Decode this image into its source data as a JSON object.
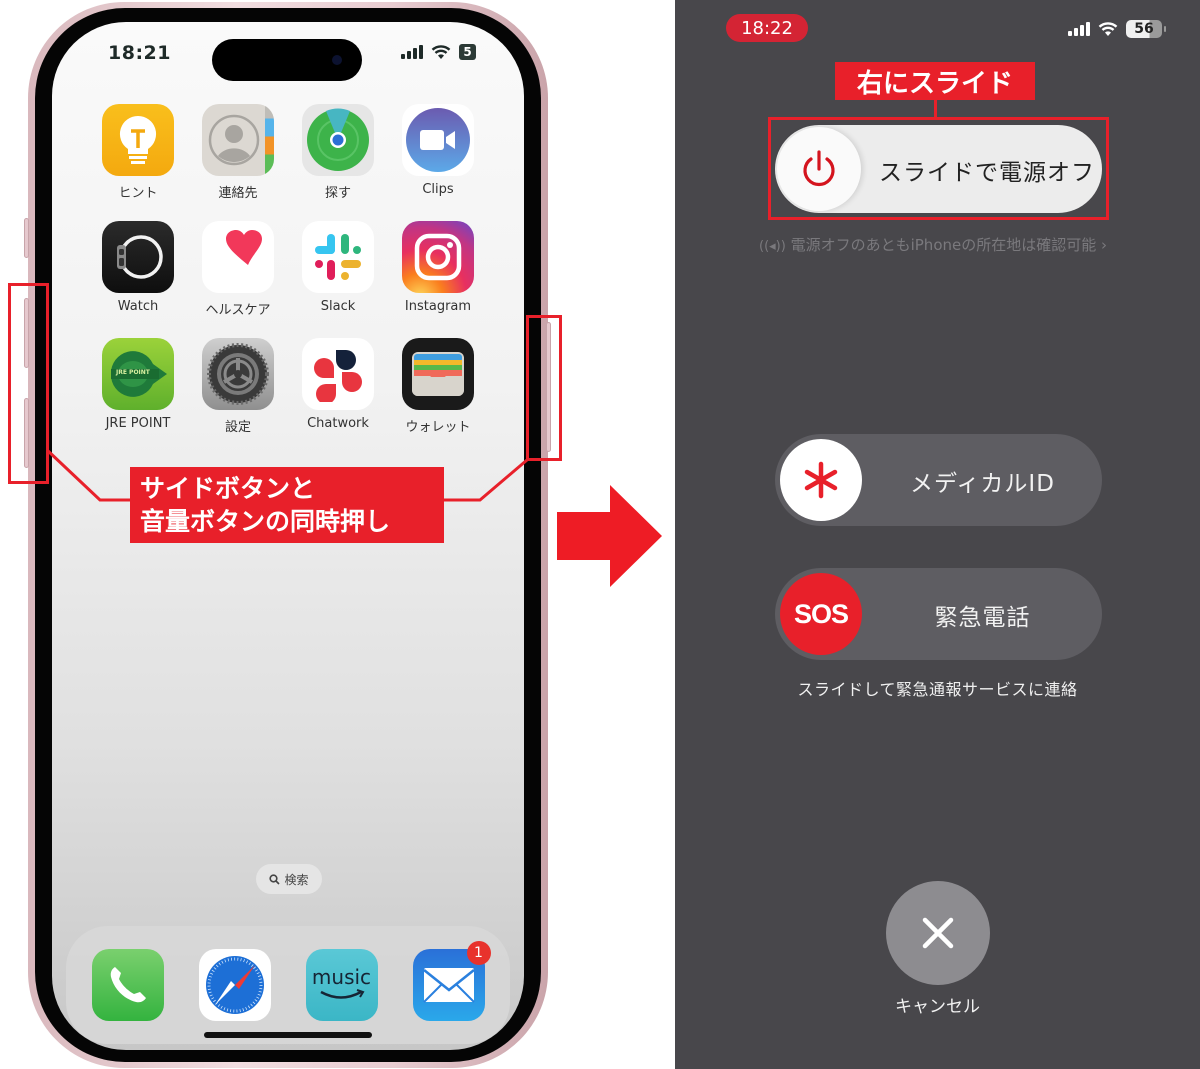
{
  "left_phone": {
    "status_bar": {
      "time": "18:21",
      "battery": "5"
    },
    "apps": [
      {
        "label": "ヒント",
        "icon": "tips-icon"
      },
      {
        "label": "連絡先",
        "icon": "contacts-icon"
      },
      {
        "label": "探す",
        "icon": "find-my-icon"
      },
      {
        "label": "Clips",
        "icon": "clips-icon"
      },
      {
        "label": "Watch",
        "icon": "watch-icon"
      },
      {
        "label": "ヘルスケア",
        "icon": "health-icon"
      },
      {
        "label": "Slack",
        "icon": "slack-icon"
      },
      {
        "label": "Instagram",
        "icon": "instagram-icon"
      },
      {
        "label": "JRE POINT",
        "icon": "jre-point-icon",
        "inner_text": "JRE POINT"
      },
      {
        "label": "設定",
        "icon": "settings-icon"
      },
      {
        "label": "Chatwork",
        "icon": "chatwork-icon"
      },
      {
        "label": "ウォレット",
        "icon": "wallet-icon"
      }
    ],
    "search": {
      "label": "検索"
    },
    "dock": [
      {
        "name": "phone",
        "icon": "phone-icon"
      },
      {
        "name": "safari",
        "icon": "safari-icon"
      },
      {
        "name": "amazon-music",
        "icon": "amazon-music-icon",
        "inner_text": "music"
      },
      {
        "name": "mail",
        "icon": "mail-icon",
        "badge": "1"
      }
    ]
  },
  "annotations": {
    "callout_line1": "サイドボタンと",
    "callout_line2": "音量ボタンの同時押し",
    "slide_tag": "右にスライド",
    "accent_color": "#e8202a"
  },
  "right_screen": {
    "status_bar": {
      "time": "18:22",
      "battery": "56"
    },
    "power_off": {
      "label": "スライドで電源オフ"
    },
    "find_my_note": "電源オフのあともiPhoneの所在地は確認可能",
    "medical_id": {
      "label": "メディカルID"
    },
    "sos": {
      "knob_label": "SOS",
      "label": "緊急電話"
    },
    "sos_note": "スライドして緊急通報サービスに連絡",
    "cancel": {
      "label": "キャンセル"
    }
  }
}
